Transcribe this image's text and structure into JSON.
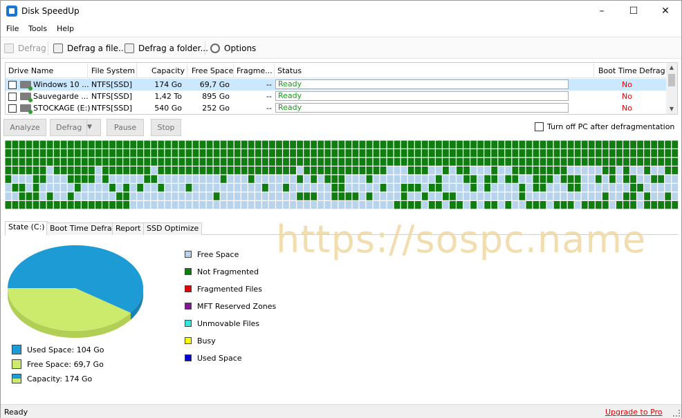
{
  "window": {
    "title": "Disk SpeedUp",
    "controls": {
      "minimize": "–",
      "maximize": "☐",
      "close": "✕"
    }
  },
  "menu": [
    "File",
    "Tools",
    "Help"
  ],
  "toolbar": {
    "defrag": "Defrag",
    "defrag_file": "Defrag a file...",
    "defrag_folder": "Defrag a folder...",
    "options": "Options"
  },
  "drives": {
    "columns": [
      "Drive Name",
      "File System",
      "Capacity",
      "Free Space",
      "Fragme...",
      "Status",
      "Boot Time Defrag"
    ],
    "rows": [
      {
        "name": "Windows 10 ...",
        "fs": "NTFS[SSD]",
        "capacity": "174 Go",
        "free": "69,7 Go",
        "frag": "--",
        "status": "Ready",
        "boot": "No",
        "selected": true
      },
      {
        "name": "Sauvegarde ...",
        "fs": "NTFS[SSD]",
        "capacity": "1,42 To",
        "free": "895 Go",
        "frag": "--",
        "status": "Ready",
        "boot": "No",
        "selected": false
      },
      {
        "name": "STOCKAGE (E:)",
        "fs": "NTFS[SSD]",
        "capacity": "540 Go",
        "free": "252 Go",
        "frag": "--",
        "status": "Ready",
        "boot": "No",
        "selected": false
      }
    ]
  },
  "actions": {
    "analyze": "Analyze",
    "defrag": "Defrag",
    "pause": "Pause",
    "stop": "Stop",
    "turn_off_label": "Turn off PC after defragmentation"
  },
  "cluster_colors": {
    "used": "#0f7d0f",
    "free": "#b7d4ec",
    "grid": "#ffffff"
  },
  "tabs": [
    "State (C:)",
    "Boot Time Defrag",
    "Report",
    "SSD Optimize"
  ],
  "state": {
    "pie": {
      "used_color": "#1d9bd4",
      "free_color": "#ccea6b",
      "used_fraction": 0.598
    },
    "legend": [
      {
        "label": "Used Space: 104 Go",
        "color": "#1d9bd4"
      },
      {
        "label": "Free Space: 69,7 Go",
        "color": "#ccea6b"
      },
      {
        "label": "Capacity: 174 Go",
        "color": "#1d9bd4",
        "color2": "#ccea6b"
      }
    ],
    "map_legend": [
      {
        "label": "Free Space",
        "color": "#b7d4ec"
      },
      {
        "label": "Not Fragmented",
        "color": "#0f7d0f"
      },
      {
        "label": "Fragmented Files",
        "color": "#e00000"
      },
      {
        "label": "MFT Reserved Zones",
        "color": "#7d1a8c"
      },
      {
        "label": "Unmovable Files",
        "color": "#33e6e6"
      },
      {
        "label": "Busy",
        "color": "#ffff00"
      },
      {
        "label": "Used Space",
        "color": "#0000d6"
      }
    ]
  },
  "watermark": "https://sospc.name",
  "statusbar": {
    "text": "Ready",
    "upgrade": "Upgrade to Pro"
  }
}
